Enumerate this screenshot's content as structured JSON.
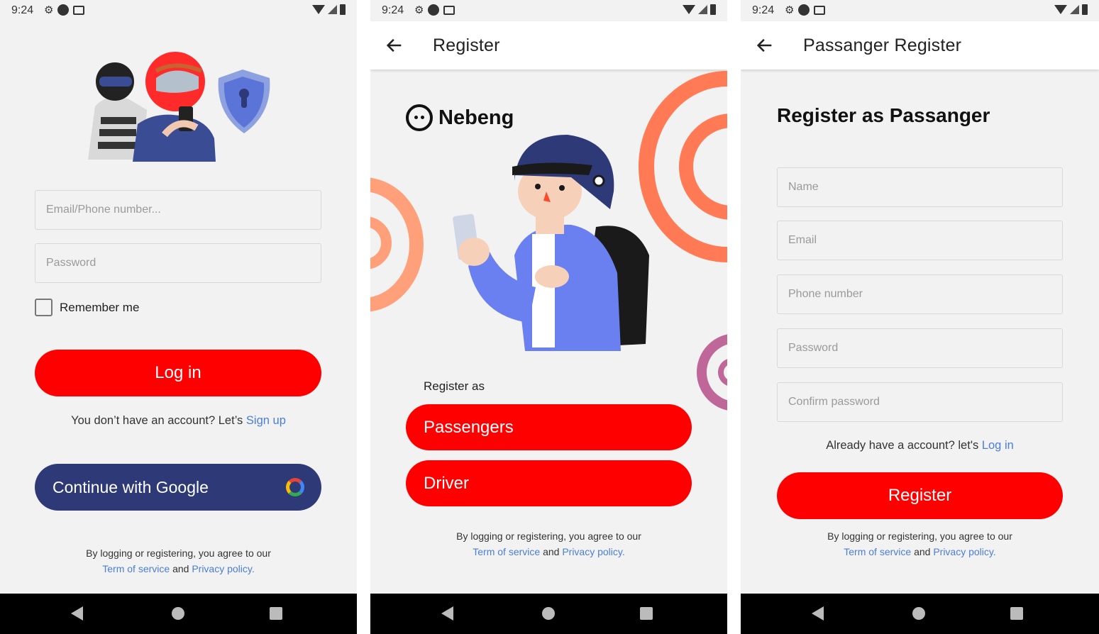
{
  "status": {
    "time": "9:24"
  },
  "login": {
    "email_placeholder": "Email/Phone number...",
    "password_placeholder": "Password",
    "remember_label": "Remember me",
    "login_label": "Log in",
    "signup_prompt": "You don’t have an account? Let’s",
    "signup_link": "Sign up",
    "google_label": "Continue with Google"
  },
  "register": {
    "title": "Register",
    "brand": "Nebeng",
    "register_as_label": "Register as",
    "options": [
      "Passengers",
      "Driver"
    ]
  },
  "passenger_register": {
    "title": "Passanger Register",
    "heading": "Register as Passanger",
    "fields": [
      "Name",
      "Email",
      "Phone number",
      "Password",
      "Confirm password"
    ],
    "login_prompt": "Already have a account? let's",
    "login_link": "Log in",
    "register_label": "Register"
  },
  "legal": {
    "line1": "By logging or registering, you agree to our",
    "terms": "Term of service",
    "and": "and",
    "privacy": "Privacy policy."
  },
  "colors": {
    "primary": "#ff0000",
    "navy": "#2e3a78",
    "link": "#4a7ed9",
    "background": "#f2f2f2"
  }
}
